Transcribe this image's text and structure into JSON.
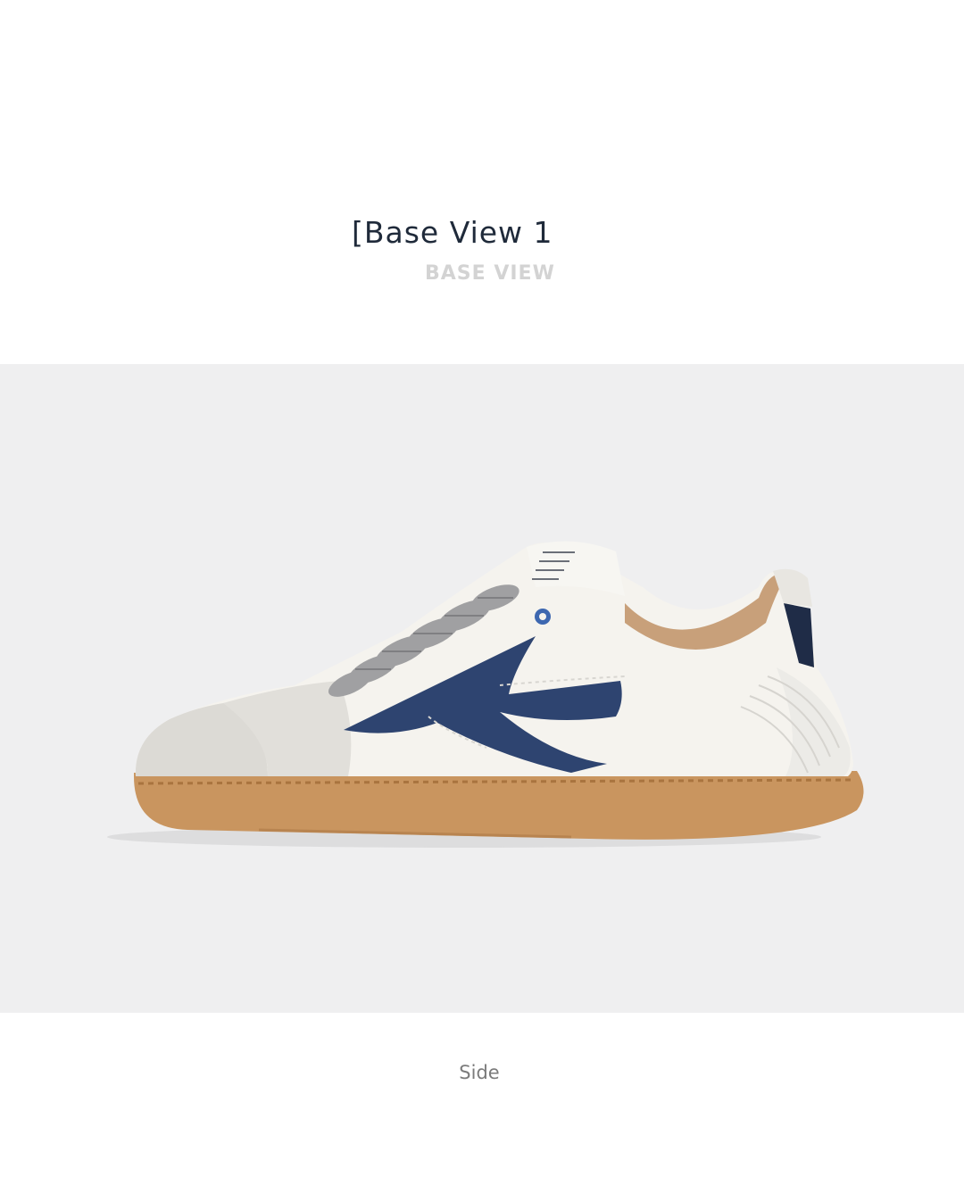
{
  "header": {
    "title": "[Base View 1",
    "subtitle": "BASE VIEW"
  },
  "photo": {
    "subject": "sneaker-side-view",
    "colors": {
      "background": "#efeff0",
      "upper": "#f5f3ee",
      "suede": "#dcdad5",
      "accent": "#2e4470",
      "sole": "#c9955f",
      "lining": "#c8a07a",
      "laces": "#a0a0a2"
    }
  },
  "caption": "Side"
}
